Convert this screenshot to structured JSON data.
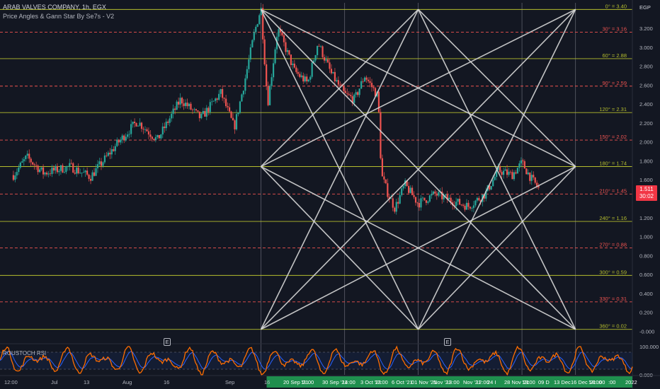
{
  "header": {
    "title": "ARAB VALVES COMPANY, 1h, EGX",
    "indicator": "Price Angles & Gann Star By Se7s - V2"
  },
  "price_badge": {
    "price": "1.511",
    "countdown": "30:02"
  },
  "currency": "EGP",
  "rsi_pane": {
    "label": "ROUSTOCH RSI",
    "ticks": [
      "100.000",
      "0.000"
    ]
  },
  "earnings_markers": [
    {
      "label": "E",
      "near_date": "Aug 15 2021"
    },
    {
      "label": "E",
      "near_date": "Oct 30 2021"
    }
  ],
  "colors": {
    "background": "#131722",
    "up_candle": "#26a69a",
    "down_candle": "#ef5350",
    "gann_lines": "#d6d6d6",
    "angle_solid": "#b5bd2e",
    "angle_dashed": "#ef5350",
    "rsi_k": "#ff6d00",
    "rsi_d": "#2962ff",
    "time_highlight": "#1f8f4e"
  },
  "chart_data": {
    "type": "candlestick",
    "x_axis_labels": [
      "12:00",
      "Jul",
      "13",
      "Aug",
      "16",
      "Sep",
      "16",
      "20 Sep '21",
      "11:00",
      "30 Sep '21",
      "14:00",
      "3 Oct '21",
      "12:00",
      "6 Oct '21",
      "01 Nov '21",
      "Nov '21",
      "13:00",
      "Nov '21",
      "12:00",
      "24 I",
      "28 Nov '21",
      "13:00",
      "09 D",
      "13 Dec",
      "16 Dec '21",
      "14:00",
      ":00",
      ":00",
      "2022"
    ],
    "y_axis": {
      "unit": "EGP",
      "ticks": [
        "3.200",
        "3.000",
        "2.800",
        "2.600",
        "2.400",
        "2.200",
        "2.000",
        "1.800",
        "1.600",
        "1.400",
        "1.200",
        "1.000",
        "0.800",
        "0.600",
        "0.400",
        "0.200",
        "-0.000"
      ],
      "range": [
        -0.02,
        3.47
      ]
    },
    "gann_angle_levels": [
      {
        "label": "0° = 3.40",
        "value": 3.4,
        "style": "solid"
      },
      {
        "label": "30° = 3.16",
        "value": 3.16,
        "style": "dashed"
      },
      {
        "label": "60° = 2.88",
        "value": 2.88,
        "style": "solid"
      },
      {
        "label": "90° = 2.59",
        "value": 2.59,
        "style": "dashed"
      },
      {
        "label": "120° = 2.31",
        "value": 2.31,
        "style": "solid"
      },
      {
        "label": "150° = 2.02",
        "value": 2.02,
        "style": "dashed"
      },
      {
        "label": "180° = 1.74",
        "value": 1.74,
        "style": "solid"
      },
      {
        "label": "210° = 1.45",
        "value": 1.45,
        "style": "dashed"
      },
      {
        "label": "240° = 1.16",
        "value": 1.16,
        "style": "solid"
      },
      {
        "label": "270° = 0.88",
        "value": 0.88,
        "style": "dashed"
      },
      {
        "label": "300° = 0.59",
        "value": 0.59,
        "style": "solid"
      },
      {
        "label": "330° = 0.31",
        "value": 0.31,
        "style": "dashed"
      },
      {
        "label": "360° = 0.02",
        "value": 0.02,
        "style": "solid"
      }
    ],
    "gann_star": {
      "time_points": [
        "Sep 13 2021",
        "Oct 30 2021",
        "Dec 16 2021"
      ],
      "top_price": 3.4,
      "middle_price": 1.74,
      "bottom_price": 0.02
    },
    "price_path": [
      {
        "date": "Jul 1 2021",
        "price": 1.65
      },
      {
        "date": "Jul 5 2021",
        "price": 1.84
      },
      {
        "date": "Jul 10 2021",
        "price": 1.67
      },
      {
        "date": "Jul 18 2021",
        "price": 1.74
      },
      {
        "date": "Jul 24 2021",
        "price": 1.63
      },
      {
        "date": "Aug 1 2021",
        "price": 1.98
      },
      {
        "date": "Aug 7 2021",
        "price": 2.22
      },
      {
        "date": "Aug 13 2021",
        "price": 2.02
      },
      {
        "date": "Aug 20 2021",
        "price": 2.45
      },
      {
        "date": "Aug 26 2021",
        "price": 2.25
      },
      {
        "date": "Sep 1 2021",
        "price": 2.52
      },
      {
        "date": "Sep 5 2021",
        "price": 2.15
      },
      {
        "date": "Sep 8 2021",
        "price": 2.62
      },
      {
        "date": "Sep 11 2021",
        "price": 3.15
      },
      {
        "date": "Sep 13 2021",
        "price": 3.42
      },
      {
        "date": "Sep 15 2021",
        "price": 2.4
      },
      {
        "date": "Sep 18 2021",
        "price": 3.2
      },
      {
        "date": "Sep 23 2021",
        "price": 2.75
      },
      {
        "date": "Sep 27 2021",
        "price": 2.62
      },
      {
        "date": "Sep 30 2021",
        "price": 3.05
      },
      {
        "date": "Oct 4 2021",
        "price": 2.72
      },
      {
        "date": "Oct 8 2021",
        "price": 2.5
      },
      {
        "date": "Oct 11 2021",
        "price": 2.45
      },
      {
        "date": "Oct 14 2021",
        "price": 2.7
      },
      {
        "date": "Oct 18 2021",
        "price": 2.48
      },
      {
        "date": "Oct 19 2021",
        "price": 1.65
      },
      {
        "date": "Oct 21 2021",
        "price": 1.45
      },
      {
        "date": "Oct 23 2021",
        "price": 1.3
      },
      {
        "date": "Oct 26 2021",
        "price": 1.55
      },
      {
        "date": "Oct 30 2021",
        "price": 1.35
      },
      {
        "date": "Nov 4 2021",
        "price": 1.45
      },
      {
        "date": "Nov 9 2021",
        "price": 1.38
      },
      {
        "date": "Nov 14 2021",
        "price": 1.32
      },
      {
        "date": "Nov 19 2021",
        "price": 1.45
      },
      {
        "date": "Nov 23 2021",
        "price": 1.7
      },
      {
        "date": "Nov 27 2021",
        "price": 1.65
      },
      {
        "date": "Nov 30 2021",
        "price": 1.78
      },
      {
        "date": "Dec 3 2021",
        "price": 1.6
      },
      {
        "date": "Dec 5 2021",
        "price": 1.51
      }
    ],
    "rsi": {
      "k_color": "#ff6d00",
      "d_color": "#2962ff",
      "range": [
        0,
        100
      ]
    }
  }
}
